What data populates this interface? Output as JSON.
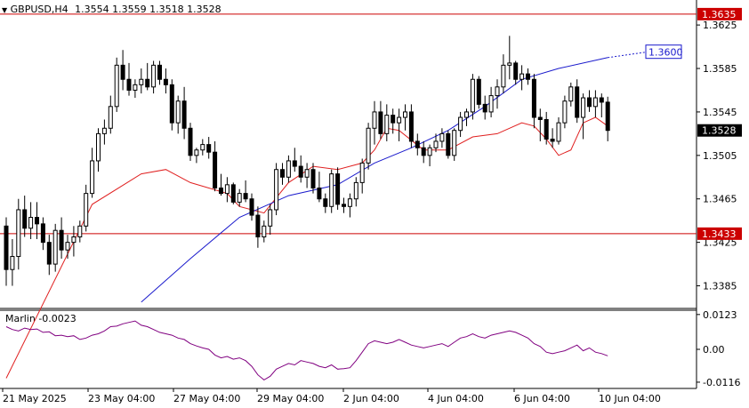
{
  "header": {
    "symbol": "GBPUSD,H4",
    "ohlc": "1.3554 1.3559 1.3518 1.3528"
  },
  "indicator": {
    "label": "Marlin -0.0023",
    "ticks": [
      "0.0123",
      "0.00",
      "-0.0116"
    ]
  },
  "levels": {
    "upper": "1.3635",
    "lower": "1.3433",
    "current": "1.3528",
    "target": "1.3600"
  },
  "colors": {
    "bull_body": "#ffffff",
    "bear_body": "#000000",
    "red_line": "#e02020",
    "blue_ma": "#1a1acc",
    "oscillator": "#800080",
    "level_line": "#cc0000"
  },
  "chart_data": {
    "type": "candlestick",
    "timeframe": "H4",
    "price_ticks": [
      "1.3625",
      "1.3585",
      "1.3545",
      "1.3505",
      "1.3465",
      "1.3425",
      "1.3385"
    ],
    "x_labels": [
      "21 May 2025",
      "23 May 04:00",
      "27 May 04:00",
      "29 May 04:00",
      "2 Jun 04:00",
      "4 Jun 04:00",
      "6 Jun 04:00",
      "10 Jun 04:00"
    ],
    "ylim": [
      1.3365,
      1.3648
    ],
    "osc_ylim": [
      -0.0135,
      0.0135
    ],
    "candles": [
      [
        1.344,
        1.3448,
        1.3385,
        1.34
      ],
      [
        1.34,
        1.3428,
        1.3385,
        1.3412
      ],
      [
        1.3412,
        1.3465,
        1.34,
        1.3455
      ],
      [
        1.3455,
        1.3468,
        1.343,
        1.3438
      ],
      [
        1.3438,
        1.3462,
        1.3428,
        1.3448
      ],
      [
        1.3448,
        1.3462,
        1.3428,
        1.3442
      ],
      [
        1.3442,
        1.3448,
        1.3418,
        1.3425
      ],
      [
        1.3425,
        1.3432,
        1.3395,
        1.3405
      ],
      [
        1.3405,
        1.3442,
        1.3398,
        1.3436
      ],
      [
        1.3436,
        1.3448,
        1.341,
        1.3418
      ],
      [
        1.3418,
        1.3432,
        1.341,
        1.3425
      ],
      [
        1.3425,
        1.344,
        1.3412,
        1.343
      ],
      [
        1.343,
        1.3445,
        1.3425,
        1.344
      ],
      [
        1.344,
        1.3478,
        1.3435,
        1.347
      ],
      [
        1.347,
        1.3512,
        1.3466,
        1.35
      ],
      [
        1.35,
        1.353,
        1.349,
        1.3525
      ],
      [
        1.3525,
        1.3538,
        1.3515,
        1.353
      ],
      [
        1.353,
        1.356,
        1.3525,
        1.355
      ],
      [
        1.355,
        1.3595,
        1.3545,
        1.3588
      ],
      [
        1.3588,
        1.3602,
        1.3565,
        1.3575
      ],
      [
        1.3575,
        1.359,
        1.356,
        1.3565
      ],
      [
        1.3565,
        1.3575,
        1.3558,
        1.357
      ],
      [
        1.357,
        1.3585,
        1.3562,
        1.3575
      ],
      [
        1.3575,
        1.359,
        1.3565,
        1.3568
      ],
      [
        1.3568,
        1.3592,
        1.3562,
        1.3588
      ],
      [
        1.3588,
        1.3592,
        1.357,
        1.3575
      ],
      [
        1.3575,
        1.3585,
        1.3562,
        1.357
      ],
      [
        1.357,
        1.3575,
        1.3528,
        1.3535
      ],
      [
        1.3535,
        1.356,
        1.3525,
        1.3555
      ],
      [
        1.3555,
        1.3568,
        1.352,
        1.353
      ],
      [
        1.353,
        1.3535,
        1.35,
        1.3505
      ],
      [
        1.3505,
        1.3512,
        1.3498,
        1.351
      ],
      [
        1.351,
        1.352,
        1.3505,
        1.3515
      ],
      [
        1.3515,
        1.3522,
        1.3502,
        1.3508
      ],
      [
        1.3508,
        1.3518,
        1.3472,
        1.3475
      ],
      [
        1.3475,
        1.3488,
        1.3468,
        1.347
      ],
      [
        1.347,
        1.3485,
        1.3462,
        1.3478
      ],
      [
        1.3478,
        1.348,
        1.346,
        1.3462
      ],
      [
        1.3462,
        1.3474,
        1.3458,
        1.347
      ],
      [
        1.347,
        1.3482,
        1.3462,
        1.3465
      ],
      [
        1.3465,
        1.347,
        1.3445,
        1.345
      ],
      [
        1.345,
        1.3458,
        1.342,
        1.343
      ],
      [
        1.343,
        1.3445,
        1.3425,
        1.344
      ],
      [
        1.344,
        1.346,
        1.3432,
        1.3455
      ],
      [
        1.3455,
        1.3498,
        1.345,
        1.3492
      ],
      [
        1.3492,
        1.3498,
        1.3478,
        1.3485
      ],
      [
        1.3485,
        1.3505,
        1.348,
        1.35
      ],
      [
        1.35,
        1.3512,
        1.349,
        1.3495
      ],
      [
        1.3495,
        1.3505,
        1.348,
        1.3485
      ],
      [
        1.3485,
        1.3498,
        1.3475,
        1.3492
      ],
      [
        1.3492,
        1.3498,
        1.347,
        1.3475
      ],
      [
        1.3475,
        1.349,
        1.3462,
        1.3465
      ],
      [
        1.3465,
        1.347,
        1.3452,
        1.3458
      ],
      [
        1.3458,
        1.3492,
        1.3452,
        1.3488
      ],
      [
        1.3488,
        1.3494,
        1.3455,
        1.346
      ],
      [
        1.346,
        1.3466,
        1.3452,
        1.3458
      ],
      [
        1.3458,
        1.347,
        1.3448,
        1.3465
      ],
      [
        1.3465,
        1.3485,
        1.3458,
        1.348
      ],
      [
        1.348,
        1.3502,
        1.347,
        1.3498
      ],
      [
        1.3498,
        1.3535,
        1.3492,
        1.353
      ],
      [
        1.353,
        1.3555,
        1.3515,
        1.3545
      ],
      [
        1.3545,
        1.3555,
        1.352,
        1.3525
      ],
      [
        1.3525,
        1.3552,
        1.3518,
        1.3542
      ],
      [
        1.3542,
        1.3548,
        1.3525,
        1.3535
      ],
      [
        1.3535,
        1.3548,
        1.3518,
        1.354
      ],
      [
        1.354,
        1.3552,
        1.3528,
        1.3545
      ],
      [
        1.3545,
        1.3552,
        1.3512,
        1.3518
      ],
      [
        1.3518,
        1.3525,
        1.3505,
        1.3512
      ],
      [
        1.3512,
        1.3518,
        1.3498,
        1.3505
      ],
      [
        1.3505,
        1.3515,
        1.3495,
        1.3512
      ],
      [
        1.3512,
        1.3525,
        1.3508,
        1.3518
      ],
      [
        1.3518,
        1.353,
        1.3512,
        1.3525
      ],
      [
        1.3525,
        1.3528,
        1.3502,
        1.3505
      ],
      [
        1.3505,
        1.353,
        1.35,
        1.3528
      ],
      [
        1.3528,
        1.3545,
        1.3522,
        1.354
      ],
      [
        1.354,
        1.3548,
        1.3532,
        1.3545
      ],
      [
        1.3545,
        1.358,
        1.3538,
        1.3575
      ],
      [
        1.3575,
        1.3578,
        1.3548,
        1.3552
      ],
      [
        1.3552,
        1.356,
        1.3538,
        1.3545
      ],
      [
        1.3545,
        1.3568,
        1.354,
        1.356
      ],
      [
        1.356,
        1.3575,
        1.3548,
        1.3568
      ],
      [
        1.3568,
        1.3598,
        1.3562,
        1.3588
      ],
      [
        1.3588,
        1.3615,
        1.3575,
        1.359
      ],
      [
        1.359,
        1.3592,
        1.357,
        1.3575
      ],
      [
        1.3575,
        1.3588,
        1.3565,
        1.358
      ],
      [
        1.358,
        1.3585,
        1.357,
        1.3575
      ],
      [
        1.3575,
        1.358,
        1.353,
        1.354
      ],
      [
        1.354,
        1.3548,
        1.3518,
        1.3538
      ],
      [
        1.3538,
        1.3545,
        1.3515,
        1.352
      ],
      [
        1.352,
        1.353,
        1.3512,
        1.3518
      ],
      [
        1.3518,
        1.354,
        1.3515,
        1.3535
      ],
      [
        1.3535,
        1.356,
        1.353,
        1.3555
      ],
      [
        1.3555,
        1.3572,
        1.355,
        1.3568
      ],
      [
        1.3568,
        1.3575,
        1.3535,
        1.354
      ],
      [
        1.354,
        1.3562,
        1.352,
        1.3558
      ],
      [
        1.3558,
        1.3565,
        1.3545,
        1.355
      ],
      [
        1.355,
        1.3565,
        1.354,
        1.3558
      ],
      [
        1.3558,
        1.3562,
        1.354,
        1.3554
      ],
      [
        1.3554,
        1.3559,
        1.3518,
        1.3528
      ]
    ],
    "red_line": [
      [
        0,
        1.33
      ],
      [
        14,
        1.346
      ],
      [
        22,
        1.3488
      ],
      [
        26,
        1.3492
      ],
      [
        30,
        1.348
      ],
      [
        36,
        1.347
      ],
      [
        38,
        1.3458
      ],
      [
        42,
        1.3452
      ],
      [
        46,
        1.348
      ],
      [
        50,
        1.3495
      ],
      [
        54,
        1.3492
      ],
      [
        58,
        1.3498
      ],
      [
        60,
        1.351
      ],
      [
        62,
        1.353
      ],
      [
        64,
        1.3528
      ],
      [
        68,
        1.351
      ],
      [
        72,
        1.351
      ],
      [
        76,
        1.3522
      ],
      [
        80,
        1.3525
      ],
      [
        84,
        1.3535
      ],
      [
        86,
        1.3532
      ],
      [
        88,
        1.352
      ],
      [
        90,
        1.3505
      ],
      [
        92,
        1.351
      ],
      [
        94,
        1.3535
      ],
      [
        96,
        1.354
      ],
      [
        98,
        1.3532
      ]
    ],
    "blue_ma": [
      [
        22,
        1.337
      ],
      [
        30,
        1.341
      ],
      [
        38,
        1.3448
      ],
      [
        46,
        1.3468
      ],
      [
        54,
        1.3478
      ],
      [
        60,
        1.3498
      ],
      [
        66,
        1.3512
      ],
      [
        72,
        1.3528
      ],
      [
        78,
        1.355
      ],
      [
        84,
        1.3575
      ],
      [
        90,
        1.3585
      ],
      [
        98,
        1.3595
      ]
    ],
    "oscillator": [
      0.008,
      0.007,
      0.0065,
      0.0075,
      0.007,
      0.0072,
      0.006,
      0.0062,
      0.0048,
      0.005,
      0.0045,
      0.0048,
      0.0035,
      0.004,
      0.005,
      0.0055,
      0.0065,
      0.008,
      0.0082,
      0.009,
      0.0095,
      0.01,
      0.0085,
      0.008,
      0.007,
      0.006,
      0.0055,
      0.005,
      0.004,
      0.0035,
      0.002,
      0.0012,
      0.0005,
      0.0,
      -0.002,
      -0.003,
      -0.0025,
      -0.0035,
      -0.003,
      -0.004,
      -0.006,
      -0.009,
      -0.0108,
      -0.0095,
      -0.007,
      -0.006,
      -0.005,
      -0.0055,
      -0.004,
      -0.0045,
      -0.005,
      -0.006,
      -0.0065,
      -0.0055,
      -0.007,
      -0.0068,
      -0.0065,
      -0.004,
      -0.001,
      0.002,
      0.003,
      0.0025,
      0.002,
      0.0025,
      0.0035,
      0.0025,
      0.0015,
      0.001,
      0.0005,
      0.001,
      0.0015,
      0.002,
      0.001,
      0.0025,
      0.004,
      0.0045,
      0.0055,
      0.0045,
      0.004,
      0.005,
      0.0055,
      0.006,
      0.0065,
      0.006,
      0.005,
      0.004,
      0.002,
      0.001,
      -0.001,
      -0.0015,
      -0.001,
      -0.0005,
      0.0005,
      0.0015,
      -0.0005,
      0.0005,
      -0.001,
      -0.0015,
      -0.0023
    ]
  }
}
